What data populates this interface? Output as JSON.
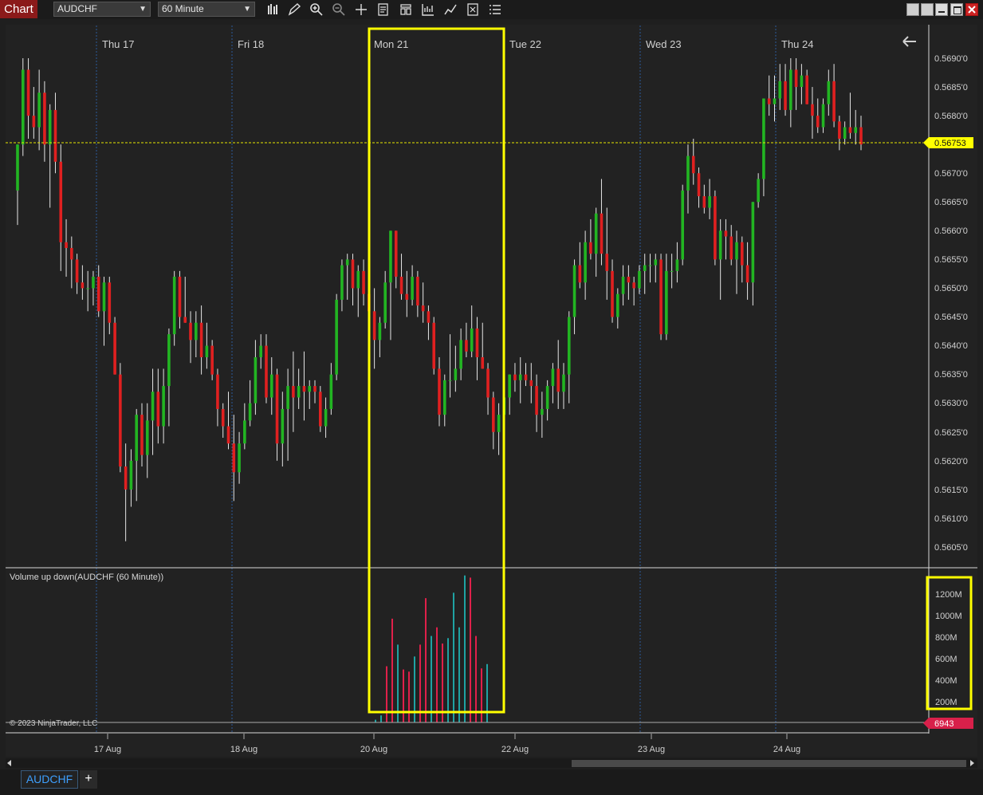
{
  "app": {
    "title": "Chart"
  },
  "toolbar": {
    "instrument": "AUDCHF",
    "interval": "60 Minute",
    "icons": [
      "bars-type-icon",
      "pencil-icon",
      "zoom-in-icon",
      "zoom-out-icon",
      "crosshair-icon",
      "properties-icon",
      "template-icon",
      "indicators-icon",
      "strategies-icon",
      "data-box-icon",
      "list-icon"
    ]
  },
  "window_icons": [
    "tile-icon",
    "tile-icon",
    "minimize-icon",
    "maximize-icon",
    "close-icon"
  ],
  "colors": {
    "background": "#1f1f1f",
    "up_candle": "#22b522",
    "down_candle": "#e02020",
    "wick": "#e6e6e6",
    "volume_up": "#1fa3a3",
    "volume_down": "#e0204a",
    "highlight": "#ffff00",
    "price_line": "#e6e600",
    "session_line": "#2c5a9a"
  },
  "session_labels": [
    "Thu 17",
    "Fri 18",
    "Mon 21",
    "Tue 22",
    "Wed 23",
    "Thu 24"
  ],
  "price_axis": [
    "0.5690'0",
    "0.5685'0",
    "0.5680'0",
    "0.5670'0",
    "0.5665'0",
    "0.5660'0",
    "0.5655'0",
    "0.5650'0",
    "0.5645'0",
    "0.5640'0",
    "0.5635'0",
    "0.5630'0",
    "0.5625'0",
    "0.5620'0",
    "0.5615'0",
    "0.5610'0",
    "0.5605'0"
  ],
  "current_price_label": "0.56753",
  "volume_panel": {
    "title": "Volume up down(AUDCHF (60 Minute))",
    "axis": [
      "1200M",
      "1000M",
      "800M",
      "600M",
      "400M",
      "200M"
    ],
    "current_label": "6943"
  },
  "date_axis": [
    "17 Aug",
    "18 Aug",
    "20 Aug",
    "22 Aug",
    "23 Aug",
    "24 Aug"
  ],
  "copyright": "© 2023 NinjaTrader, LLC",
  "bottom_tabs": {
    "active": "AUDCHF",
    "add": "+"
  },
  "chart_data": {
    "type": "candlestick",
    "title": "AUDCHF (60 Minute)",
    "ylim": [
      0.56025,
      0.56925
    ],
    "current_price": 0.56753,
    "candles": [
      {
        "o": 0.5667,
        "h": 0.5675,
        "l": 0.5661,
        "c": 0.5675
      },
      {
        "o": 0.5675,
        "h": 0.569,
        "l": 0.5673,
        "c": 0.5688
      },
      {
        "o": 0.5688,
        "h": 0.569,
        "l": 0.5676,
        "c": 0.568
      },
      {
        "o": 0.568,
        "h": 0.5685,
        "l": 0.5676,
        "c": 0.5678
      },
      {
        "o": 0.5678,
        "h": 0.5688,
        "l": 0.5674,
        "c": 0.5684
      },
      {
        "o": 0.5684,
        "h": 0.5686,
        "l": 0.5672,
        "c": 0.5675
      },
      {
        "o": 0.5675,
        "h": 0.5682,
        "l": 0.5664,
        "c": 0.5681
      },
      {
        "o": 0.5681,
        "h": 0.5684,
        "l": 0.567,
        "c": 0.5672
      },
      {
        "o": 0.5672,
        "h": 0.5675,
        "l": 0.5653,
        "c": 0.5658
      },
      {
        "o": 0.5658,
        "h": 0.5662,
        "l": 0.5652,
        "c": 0.5657
      },
      {
        "o": 0.5657,
        "h": 0.5659,
        "l": 0.565,
        "c": 0.5655
      },
      {
        "o": 0.5655,
        "h": 0.5656,
        "l": 0.5649,
        "c": 0.5651
      },
      {
        "o": 0.5651,
        "h": 0.5654,
        "l": 0.5648,
        "c": 0.565
      },
      {
        "o": 0.565,
        "h": 0.5653,
        "l": 0.5646,
        "c": 0.565
      },
      {
        "o": 0.565,
        "h": 0.5653,
        "l": 0.5647,
        "c": 0.5652
      },
      {
        "o": 0.5652,
        "h": 0.5654,
        "l": 0.5645,
        "c": 0.5646
      },
      {
        "o": 0.5646,
        "h": 0.5652,
        "l": 0.564,
        "c": 0.5651
      },
      {
        "o": 0.5651,
        "h": 0.5652,
        "l": 0.5642,
        "c": 0.5644
      },
      {
        "o": 0.5644,
        "h": 0.5645,
        "l": 0.5635,
        "c": 0.5635
      },
      {
        "o": 0.5635,
        "h": 0.5637,
        "l": 0.5618,
        "c": 0.5619
      },
      {
        "o": 0.5619,
        "h": 0.5623,
        "l": 0.5606,
        "c": 0.5615
      },
      {
        "o": 0.5615,
        "h": 0.5622,
        "l": 0.5612,
        "c": 0.562
      },
      {
        "o": 0.562,
        "h": 0.5629,
        "l": 0.5613,
        "c": 0.5628
      },
      {
        "o": 0.5628,
        "h": 0.563,
        "l": 0.5619,
        "c": 0.5621
      },
      {
        "o": 0.5621,
        "h": 0.563,
        "l": 0.5617,
        "c": 0.5627
      },
      {
        "o": 0.5627,
        "h": 0.5636,
        "l": 0.5621,
        "c": 0.5632
      },
      {
        "o": 0.5632,
        "h": 0.5636,
        "l": 0.5623,
        "c": 0.5626
      },
      {
        "o": 0.5626,
        "h": 0.5636,
        "l": 0.5623,
        "c": 0.5633
      },
      {
        "o": 0.5633,
        "h": 0.5643,
        "l": 0.5626,
        "c": 0.5642
      },
      {
        "o": 0.5642,
        "h": 0.5653,
        "l": 0.564,
        "c": 0.5652
      },
      {
        "o": 0.5652,
        "h": 0.5653,
        "l": 0.5643,
        "c": 0.5645
      },
      {
        "o": 0.5645,
        "h": 0.5652,
        "l": 0.5644,
        "c": 0.5644
      },
      {
        "o": 0.5644,
        "h": 0.5646,
        "l": 0.5637,
        "c": 0.5641
      },
      {
        "o": 0.5641,
        "h": 0.5646,
        "l": 0.5638,
        "c": 0.5644
      },
      {
        "o": 0.5644,
        "h": 0.5647,
        "l": 0.5635,
        "c": 0.5638
      },
      {
        "o": 0.5638,
        "h": 0.5644,
        "l": 0.5636,
        "c": 0.564
      },
      {
        "o": 0.564,
        "h": 0.5641,
        "l": 0.5634,
        "c": 0.5635
      },
      {
        "o": 0.5635,
        "h": 0.5636,
        "l": 0.5626,
        "c": 0.5629
      },
      {
        "o": 0.5629,
        "h": 0.563,
        "l": 0.5624,
        "c": 0.5626
      },
      {
        "o": 0.5626,
        "h": 0.5632,
        "l": 0.5622,
        "c": 0.5623
      },
      {
        "o": 0.5623,
        "h": 0.5628,
        "l": 0.5613,
        "c": 0.5618
      },
      {
        "o": 0.5618,
        "h": 0.5625,
        "l": 0.5616,
        "c": 0.5623
      },
      {
        "o": 0.5623,
        "h": 0.563,
        "l": 0.5622,
        "c": 0.5627
      },
      {
        "o": 0.5627,
        "h": 0.5634,
        "l": 0.5626,
        "c": 0.563
      },
      {
        "o": 0.563,
        "h": 0.5641,
        "l": 0.5628,
        "c": 0.5638
      },
      {
        "o": 0.5638,
        "h": 0.5642,
        "l": 0.5636,
        "c": 0.564
      },
      {
        "o": 0.564,
        "h": 0.5642,
        "l": 0.563,
        "c": 0.5631
      },
      {
        "o": 0.5631,
        "h": 0.5638,
        "l": 0.5628,
        "c": 0.5635
      },
      {
        "o": 0.5635,
        "h": 0.5636,
        "l": 0.562,
        "c": 0.5623
      },
      {
        "o": 0.5623,
        "h": 0.5632,
        "l": 0.5619,
        "c": 0.5629
      },
      {
        "o": 0.5629,
        "h": 0.5636,
        "l": 0.562,
        "c": 0.5633
      },
      {
        "o": 0.5633,
        "h": 0.5639,
        "l": 0.5625,
        "c": 0.5631
      },
      {
        "o": 0.5631,
        "h": 0.5636,
        "l": 0.5629,
        "c": 0.5633
      },
      {
        "o": 0.5633,
        "h": 0.5639,
        "l": 0.5627,
        "c": 0.5632
      },
      {
        "o": 0.5632,
        "h": 0.5634,
        "l": 0.5629,
        "c": 0.5633
      },
      {
        "o": 0.5633,
        "h": 0.5634,
        "l": 0.563,
        "c": 0.5632
      },
      {
        "o": 0.5632,
        "h": 0.5633,
        "l": 0.5625,
        "c": 0.5626
      },
      {
        "o": 0.5626,
        "h": 0.5631,
        "l": 0.5624,
        "c": 0.5629
      },
      {
        "o": 0.5629,
        "h": 0.5637,
        "l": 0.5628,
        "c": 0.5635
      },
      {
        "o": 0.5635,
        "h": 0.5649,
        "l": 0.5634,
        "c": 0.5648
      },
      {
        "o": 0.5648,
        "h": 0.5655,
        "l": 0.5646,
        "c": 0.5654
      },
      {
        "o": 0.5654,
        "h": 0.5656,
        "l": 0.5648,
        "c": 0.5655
      },
      {
        "o": 0.5655,
        "h": 0.5656,
        "l": 0.5647,
        "c": 0.565
      },
      {
        "o": 0.565,
        "h": 0.5654,
        "l": 0.5645,
        "c": 0.5653
      },
      {
        "o": 0.5653,
        "h": 0.5655,
        "l": 0.5647,
        "c": 0.5649
      },
      {
        "o": 0.5649,
        "h": 0.565,
        "l": 0.5639,
        "c": 0.5646
      },
      {
        "o": 0.5646,
        "h": 0.565,
        "l": 0.5636,
        "c": 0.5641
      },
      {
        "o": 0.5641,
        "h": 0.5645,
        "l": 0.5638,
        "c": 0.5644
      },
      {
        "o": 0.5644,
        "h": 0.5653,
        "l": 0.5643,
        "c": 0.5651
      },
      {
        "o": 0.5651,
        "h": 0.566,
        "l": 0.5641,
        "c": 0.566
      },
      {
        "o": 0.566,
        "h": 0.566,
        "l": 0.565,
        "c": 0.5652
      },
      {
        "o": 0.5652,
        "h": 0.5656,
        "l": 0.5648,
        "c": 0.5649
      },
      {
        "o": 0.5649,
        "h": 0.5653,
        "l": 0.5645,
        "c": 0.5648
      },
      {
        "o": 0.5648,
        "h": 0.5654,
        "l": 0.5647,
        "c": 0.5652
      },
      {
        "o": 0.5652,
        "h": 0.5653,
        "l": 0.5645,
        "c": 0.5647
      },
      {
        "o": 0.5647,
        "h": 0.5651,
        "l": 0.5644,
        "c": 0.5646
      },
      {
        "o": 0.5646,
        "h": 0.5647,
        "l": 0.5641,
        "c": 0.5644
      },
      {
        "o": 0.5644,
        "h": 0.5645,
        "l": 0.5635,
        "c": 0.5636
      },
      {
        "o": 0.5636,
        "h": 0.5638,
        "l": 0.5626,
        "c": 0.5628
      },
      {
        "o": 0.5628,
        "h": 0.5635,
        "l": 0.5626,
        "c": 0.5634
      },
      {
        "o": 0.5634,
        "h": 0.5642,
        "l": 0.5631,
        "c": 0.5634
      },
      {
        "o": 0.5634,
        "h": 0.564,
        "l": 0.5632,
        "c": 0.5636
      },
      {
        "o": 0.5636,
        "h": 0.5643,
        "l": 0.5634,
        "c": 0.5641
      },
      {
        "o": 0.5641,
        "h": 0.5644,
        "l": 0.5638,
        "c": 0.5639
      },
      {
        "o": 0.5639,
        "h": 0.5647,
        "l": 0.5638,
        "c": 0.5643
      },
      {
        "o": 0.5643,
        "h": 0.5645,
        "l": 0.5634,
        "c": 0.5638
      },
      {
        "o": 0.5638,
        "h": 0.5644,
        "l": 0.5636,
        "c": 0.5636
      },
      {
        "o": 0.5636,
        "h": 0.5637,
        "l": 0.5628,
        "c": 0.5631
      },
      {
        "o": 0.5631,
        "h": 0.5632,
        "l": 0.5622,
        "c": 0.5625
      },
      {
        "o": 0.5625,
        "h": 0.563,
        "l": 0.5621,
        "c": 0.5628
      },
      {
        "o": 0.5628,
        "h": 0.5633,
        "l": 0.5627,
        "c": 0.5631
      },
      {
        "o": 0.5631,
        "h": 0.5635,
        "l": 0.5628,
        "c": 0.5635
      },
      {
        "o": 0.5635,
        "h": 0.5637,
        "l": 0.5632,
        "c": 0.5634
      },
      {
        "o": 0.5634,
        "h": 0.5638,
        "l": 0.563,
        "c": 0.5635
      },
      {
        "o": 0.5635,
        "h": 0.5637,
        "l": 0.5633,
        "c": 0.5634
      },
      {
        "o": 0.5634,
        "h": 0.5637,
        "l": 0.563,
        "c": 0.5633
      },
      {
        "o": 0.5633,
        "h": 0.5635,
        "l": 0.5625,
        "c": 0.5628
      },
      {
        "o": 0.5628,
        "h": 0.5632,
        "l": 0.5624,
        "c": 0.5629
      },
      {
        "o": 0.5629,
        "h": 0.5634,
        "l": 0.5627,
        "c": 0.5633
      },
      {
        "o": 0.5633,
        "h": 0.5637,
        "l": 0.563,
        "c": 0.5636
      },
      {
        "o": 0.5636,
        "h": 0.5641,
        "l": 0.5629,
        "c": 0.5632
      },
      {
        "o": 0.5632,
        "h": 0.5637,
        "l": 0.5629,
        "c": 0.5635
      },
      {
        "o": 0.5635,
        "h": 0.5646,
        "l": 0.563,
        "c": 0.5645
      },
      {
        "o": 0.5645,
        "h": 0.5655,
        "l": 0.5642,
        "c": 0.5654
      },
      {
        "o": 0.5654,
        "h": 0.5658,
        "l": 0.565,
        "c": 0.5651
      },
      {
        "o": 0.5651,
        "h": 0.566,
        "l": 0.5648,
        "c": 0.5658
      },
      {
        "o": 0.5658,
        "h": 0.5662,
        "l": 0.5655,
        "c": 0.5656
      },
      {
        "o": 0.5656,
        "h": 0.5664,
        "l": 0.5652,
        "c": 0.5663
      },
      {
        "o": 0.5663,
        "h": 0.5669,
        "l": 0.5654,
        "c": 0.5656
      },
      {
        "o": 0.5656,
        "h": 0.5664,
        "l": 0.5648,
        "c": 0.5653
      },
      {
        "o": 0.5653,
        "h": 0.5655,
        "l": 0.5644,
        "c": 0.5645
      },
      {
        "o": 0.5645,
        "h": 0.565,
        "l": 0.5643,
        "c": 0.5649
      },
      {
        "o": 0.5649,
        "h": 0.5654,
        "l": 0.5647,
        "c": 0.5652
      },
      {
        "o": 0.5652,
        "h": 0.5654,
        "l": 0.5648,
        "c": 0.5651
      },
      {
        "o": 0.5651,
        "h": 0.5652,
        "l": 0.5647,
        "c": 0.565
      },
      {
        "o": 0.565,
        "h": 0.5654,
        "l": 0.5649,
        "c": 0.5653
      },
      {
        "o": 0.5653,
        "h": 0.5656,
        "l": 0.5649,
        "c": 0.5654
      },
      {
        "o": 0.5654,
        "h": 0.5656,
        "l": 0.5651,
        "c": 0.5654
      },
      {
        "o": 0.5654,
        "h": 0.5656,
        "l": 0.5651,
        "c": 0.5655
      },
      {
        "o": 0.5655,
        "h": 0.5656,
        "l": 0.5641,
        "c": 0.5642
      },
      {
        "o": 0.5642,
        "h": 0.5656,
        "l": 0.5641,
        "c": 0.5653
      },
      {
        "o": 0.5653,
        "h": 0.5656,
        "l": 0.565,
        "c": 0.5653
      },
      {
        "o": 0.5653,
        "h": 0.5658,
        "l": 0.5651,
        "c": 0.5655
      },
      {
        "o": 0.5655,
        "h": 0.5668,
        "l": 0.5654,
        "c": 0.5667
      },
      {
        "o": 0.5667,
        "h": 0.5675,
        "l": 0.5663,
        "c": 0.5673
      },
      {
        "o": 0.5673,
        "h": 0.5676,
        "l": 0.5668,
        "c": 0.567
      },
      {
        "o": 0.567,
        "h": 0.5671,
        "l": 0.5664,
        "c": 0.5666
      },
      {
        "o": 0.5666,
        "h": 0.5668,
        "l": 0.5663,
        "c": 0.5664
      },
      {
        "o": 0.5664,
        "h": 0.5669,
        "l": 0.5662,
        "c": 0.5666
      },
      {
        "o": 0.5666,
        "h": 0.5667,
        "l": 0.5654,
        "c": 0.5655
      },
      {
        "o": 0.5655,
        "h": 0.5662,
        "l": 0.5648,
        "c": 0.566
      },
      {
        "o": 0.566,
        "h": 0.5662,
        "l": 0.5655,
        "c": 0.5659
      },
      {
        "o": 0.5659,
        "h": 0.5661,
        "l": 0.5654,
        "c": 0.5655
      },
      {
        "o": 0.5655,
        "h": 0.566,
        "l": 0.5649,
        "c": 0.5658
      },
      {
        "o": 0.5658,
        "h": 0.5659,
        "l": 0.5651,
        "c": 0.5654
      },
      {
        "o": 0.5654,
        "h": 0.5658,
        "l": 0.5648,
        "c": 0.5651
      },
      {
        "o": 0.5651,
        "h": 0.5665,
        "l": 0.5647,
        "c": 0.5665
      },
      {
        "o": 0.5665,
        "h": 0.567,
        "l": 0.5664,
        "c": 0.5669
      },
      {
        "o": 0.5669,
        "h": 0.5683,
        "l": 0.5666,
        "c": 0.5683
      },
      {
        "o": 0.5683,
        "h": 0.5687,
        "l": 0.568,
        "c": 0.5682
      },
      {
        "o": 0.5682,
        "h": 0.5687,
        "l": 0.5679,
        "c": 0.5683
      },
      {
        "o": 0.5683,
        "h": 0.5689,
        "l": 0.5681,
        "c": 0.5686
      },
      {
        "o": 0.5686,
        "h": 0.5689,
        "l": 0.568,
        "c": 0.5681
      },
      {
        "o": 0.5681,
        "h": 0.569,
        "l": 0.5678,
        "c": 0.5688
      },
      {
        "o": 0.5688,
        "h": 0.569,
        "l": 0.5681,
        "c": 0.5685
      },
      {
        "o": 0.5685,
        "h": 0.5689,
        "l": 0.5682,
        "c": 0.5687
      },
      {
        "o": 0.5687,
        "h": 0.5688,
        "l": 0.5682,
        "c": 0.5682
      },
      {
        "o": 0.5682,
        "h": 0.5685,
        "l": 0.5676,
        "c": 0.568
      },
      {
        "o": 0.568,
        "h": 0.5683,
        "l": 0.5677,
        "c": 0.5678
      },
      {
        "o": 0.5678,
        "h": 0.5683,
        "l": 0.5677,
        "c": 0.5682
      },
      {
        "o": 0.5682,
        "h": 0.5688,
        "l": 0.568,
        "c": 0.5686
      },
      {
        "o": 0.5686,
        "h": 0.5689,
        "l": 0.5678,
        "c": 0.5679
      },
      {
        "o": 0.5679,
        "h": 0.568,
        "l": 0.5674,
        "c": 0.5676
      },
      {
        "o": 0.5676,
        "h": 0.5679,
        "l": 0.5675,
        "c": 0.5678
      },
      {
        "o": 0.5678,
        "h": 0.5684,
        "l": 0.5676,
        "c": 0.5677
      },
      {
        "o": 0.5677,
        "h": 0.5681,
        "l": 0.5675,
        "c": 0.5678
      },
      {
        "o": 0.5678,
        "h": 0.568,
        "l": 0.5674,
        "c": 0.5675
      }
    ],
    "volume": [
      {
        "v": 25,
        "up": true
      },
      {
        "v": 65,
        "up": true
      },
      {
        "v": 520,
        "up": false
      },
      {
        "v": 960,
        "up": false
      },
      {
        "v": 720,
        "up": true
      },
      {
        "v": 490,
        "up": false
      },
      {
        "v": 470,
        "up": false
      },
      {
        "v": 610,
        "up": true
      },
      {
        "v": 720,
        "up": false
      },
      {
        "v": 1150,
        "up": false
      },
      {
        "v": 800,
        "up": true
      },
      {
        "v": 880,
        "up": false
      },
      {
        "v": 730,
        "up": false
      },
      {
        "v": 780,
        "up": true
      },
      {
        "v": 1200,
        "up": true
      },
      {
        "v": 880,
        "up": true
      },
      {
        "v": 1360,
        "up": true
      },
      {
        "v": 1340,
        "up": false
      },
      {
        "v": 800,
        "up": false
      },
      {
        "v": 500,
        "up": false
      },
      {
        "v": 540,
        "up": true
      }
    ],
    "volume_ylim": [
      0,
      1400
    ]
  }
}
